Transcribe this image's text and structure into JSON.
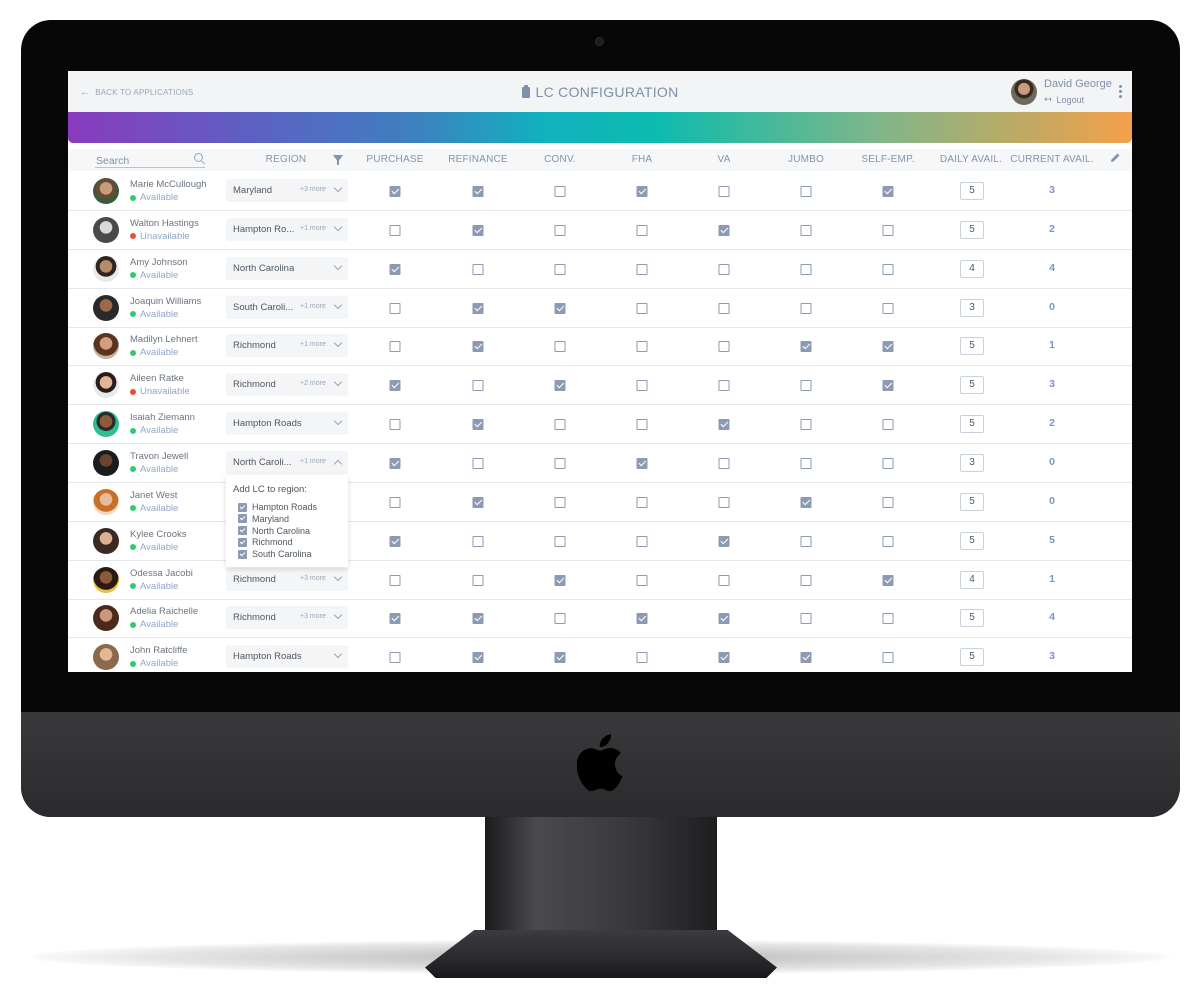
{
  "header": {
    "back_label": "BACK TO APPLICATIONS",
    "title": "LC CONFIGURATION",
    "user_name": "David George",
    "logout_label": "Logout"
  },
  "table": {
    "search_placeholder": "Search",
    "columns": [
      "REGION",
      "PURCHASE",
      "REFINANCE",
      "CONV.",
      "FHA",
      "VA",
      "JUMBO",
      "SELF-EMP.",
      "DAILY AVAIL.",
      "CURRENT AVAIL."
    ],
    "rows": [
      {
        "name": "Marie McCullough",
        "status": "Available",
        "available": true,
        "region": "Maryland",
        "more": "+3 more",
        "checks": [
          true,
          true,
          false,
          true,
          false,
          false,
          true
        ],
        "daily": "5",
        "current": "3"
      },
      {
        "name": "Walton Hastings",
        "status": "Unavailable",
        "available": false,
        "region": "Hampton Ro...",
        "more": "+1 more",
        "checks": [
          false,
          true,
          false,
          false,
          true,
          false,
          false
        ],
        "daily": "5",
        "current": "2"
      },
      {
        "name": "Amy Johnson",
        "status": "Available",
        "available": true,
        "region": "North Carolina",
        "more": "",
        "checks": [
          true,
          false,
          false,
          false,
          false,
          false,
          false
        ],
        "daily": "4",
        "current": "4"
      },
      {
        "name": "Joaquin Williams",
        "status": "Available",
        "available": true,
        "region": "South Caroli...",
        "more": "+1 more",
        "checks": [
          false,
          true,
          true,
          false,
          false,
          false,
          false
        ],
        "daily": "3",
        "current": "0"
      },
      {
        "name": "Madilyn Lehnert",
        "status": "Available",
        "available": true,
        "region": "Richmond",
        "more": "+1 more",
        "checks": [
          false,
          true,
          false,
          false,
          false,
          true,
          true
        ],
        "daily": "5",
        "current": "1"
      },
      {
        "name": "Aileen Ratke",
        "status": "Unavailable",
        "available": false,
        "region": "Richmond",
        "more": "+2 more",
        "checks": [
          true,
          false,
          true,
          false,
          false,
          false,
          true
        ],
        "daily": "5",
        "current": "3"
      },
      {
        "name": "Isaiah Ziemann",
        "status": "Available",
        "available": true,
        "region": "Hampton Roads",
        "more": "",
        "checks": [
          false,
          true,
          false,
          false,
          true,
          false,
          false
        ],
        "daily": "5",
        "current": "2"
      },
      {
        "name": "Travon Jewell",
        "status": "Available",
        "available": true,
        "region": "North Caroli...",
        "more": "+1 more",
        "checks": [
          true,
          false,
          false,
          true,
          false,
          false,
          false
        ],
        "daily": "3",
        "current": "0",
        "open": true
      },
      {
        "name": "Janet West",
        "status": "Available",
        "available": true,
        "region": "",
        "more": "",
        "checks": [
          false,
          true,
          false,
          false,
          false,
          true,
          false
        ],
        "daily": "5",
        "current": "0"
      },
      {
        "name": "Kylee Crooks",
        "status": "Available",
        "available": true,
        "region": "",
        "more": "",
        "checks": [
          true,
          false,
          false,
          false,
          true,
          false,
          false
        ],
        "daily": "5",
        "current": "5"
      },
      {
        "name": "Odessa Jacobi",
        "status": "Available",
        "available": true,
        "region": "Richmond",
        "more": "+3 more",
        "checks": [
          false,
          false,
          true,
          false,
          false,
          false,
          true
        ],
        "daily": "4",
        "current": "1"
      },
      {
        "name": "Adelia Raichelle",
        "status": "Available",
        "available": true,
        "region": "Richmond",
        "more": "+3 more",
        "checks": [
          true,
          true,
          false,
          true,
          true,
          false,
          false
        ],
        "daily": "5",
        "current": "4"
      },
      {
        "name": "John Ratcliffe",
        "status": "Available",
        "available": true,
        "region": "Hampton Roads",
        "more": "",
        "checks": [
          false,
          true,
          true,
          false,
          true,
          true,
          false
        ],
        "daily": "5",
        "current": "3"
      }
    ]
  },
  "dropdown": {
    "title": "Add LC to region:",
    "options": [
      "Hampton Roads",
      "Maryland",
      "North Carolina",
      "Richmond",
      "South Carolina"
    ],
    "checked": [
      true,
      true,
      true,
      true,
      true
    ]
  },
  "colors": {
    "available_dot": "#2ecc71",
    "unavailable_dot": "#e74c3c",
    "accent": "#7e90ab",
    "gradient": [
      "#8a3bbd",
      "#11b2be",
      "#f4a04a"
    ]
  },
  "icons": [
    "back-arrow-icon",
    "clipboard-icon",
    "search-icon",
    "filter-icon",
    "edit-pencil-icon",
    "logout-icon",
    "kebab-menu-icon",
    "chevron-down-icon",
    "apple-logo-icon"
  ]
}
